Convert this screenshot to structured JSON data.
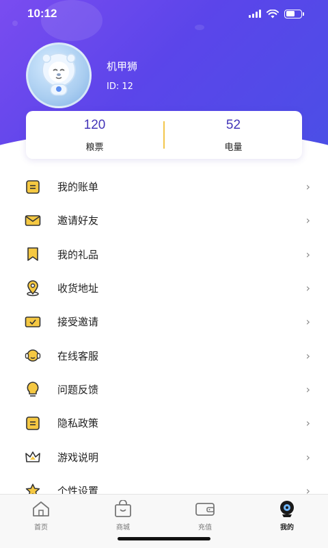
{
  "status_bar": {
    "time": "10:12"
  },
  "profile": {
    "name": "机甲狮",
    "id": "ID: 12"
  },
  "stats": [
    {
      "value": "120",
      "label": "粮票"
    },
    {
      "value": "52",
      "label": "电量"
    }
  ],
  "menu": [
    {
      "label": "我的账单",
      "icon": "bill-icon"
    },
    {
      "label": "邀请好友",
      "icon": "envelope-icon"
    },
    {
      "label": "我的礼品",
      "icon": "bookmark-icon"
    },
    {
      "label": "收货地址",
      "icon": "location-icon"
    },
    {
      "label": "接受邀请",
      "icon": "check-mail-icon"
    },
    {
      "label": "在线客服",
      "icon": "headset-icon"
    },
    {
      "label": "问题反馈",
      "icon": "bulb-icon"
    },
    {
      "label": "隐私政策",
      "icon": "document-icon"
    },
    {
      "label": "游戏说明",
      "icon": "crown-icon"
    },
    {
      "label": "个性设置",
      "icon": "star-icon"
    }
  ],
  "tabs": [
    {
      "label": "首页",
      "icon": "home-icon"
    },
    {
      "label": "商城",
      "icon": "shopping-bag-icon"
    },
    {
      "label": "充值",
      "icon": "wallet-icon"
    },
    {
      "label": "我的",
      "icon": "profile-icon",
      "active": true
    }
  ],
  "colors": {
    "accent": "#4335b8",
    "icon_yellow": "#f5c842",
    "header": "#5b45ea"
  }
}
